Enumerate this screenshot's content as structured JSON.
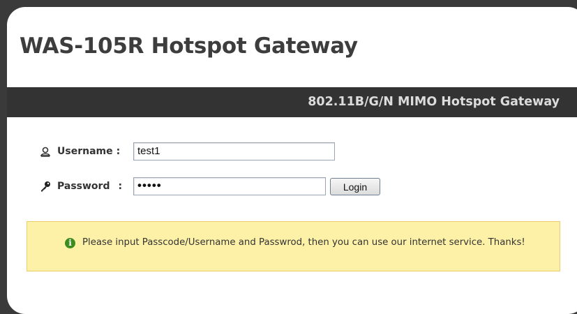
{
  "header": {
    "title": "WAS-105R Hotspot Gateway",
    "subtitle": "802.11B/G/N MIMO Hotspot Gateway"
  },
  "login": {
    "username_label": "Username",
    "username_value": "test1",
    "password_label": "Password",
    "password_value": "•••••",
    "login_button": "Login",
    "colon": ":"
  },
  "notice": {
    "text": "Please input Passcode/Username and Passwrod, then you can use our internet service. Thanks!",
    "icon_glyph": "i",
    "icon_name": "info-icon",
    "background_color": "#fdf1a8",
    "icon_color": "#3d8c1f"
  },
  "icons": {
    "username": "user-icon",
    "password": "key-icon"
  },
  "colors": {
    "header_bar": "#333333",
    "header_bar_text": "#dcdcdc",
    "title_text": "#3d3d3d"
  }
}
